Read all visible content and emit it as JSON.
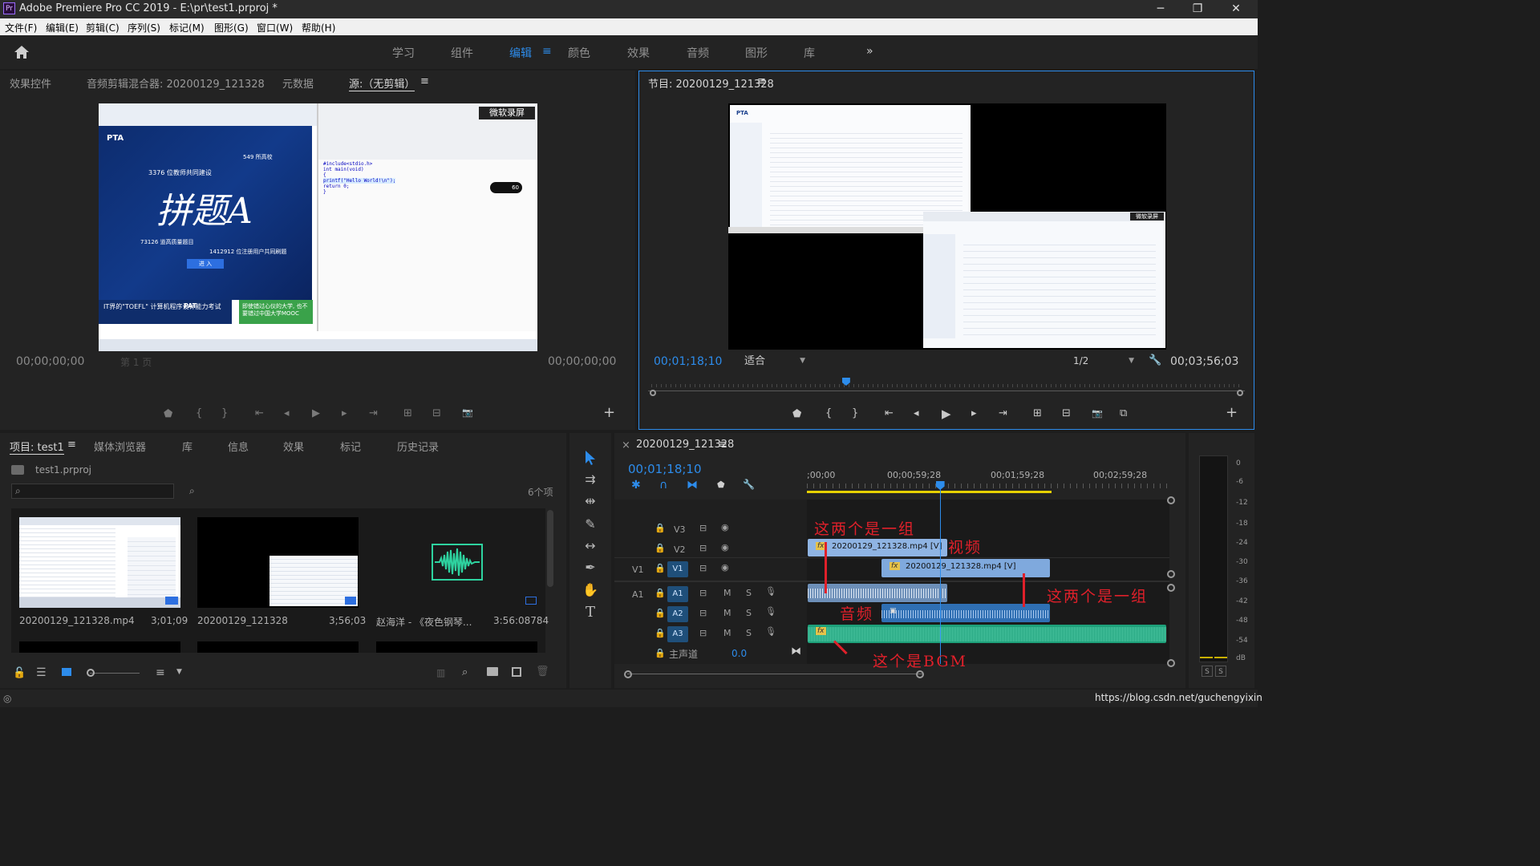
{
  "app": {
    "title": "Adobe Premiere Pro CC 2019 - E:\\pr\\test1.prproj *",
    "logo_text": "Pr"
  },
  "window_controls": {
    "minimize": "─",
    "maximize": "❐",
    "close": "✕"
  },
  "menu": [
    "文件(F)",
    "编辑(E)",
    "剪辑(C)",
    "序列(S)",
    "标记(M)",
    "图形(G)",
    "窗口(W)",
    "帮助(H)"
  ],
  "workspaces": {
    "items": [
      "学习",
      "组件",
      "编辑",
      "颜色",
      "效果",
      "音频",
      "图形",
      "库"
    ],
    "active": "编辑",
    "menu_glyph": "≡",
    "overflow": "»"
  },
  "source_panel": {
    "tabs": [
      "效果控件",
      "音频剪辑混合器: 20200129_121328",
      "元数据",
      "源:（无剪辑）"
    ],
    "menu_glyph": "≡",
    "timecode_left": "00;00;00;00",
    "timecode_right": "00;00;00;00",
    "page_selector": "第 1 页",
    "preview_text": {
      "pta_logo": "PTA",
      "banner_3376": "3376 位教师共同建设",
      "big_title": "拼题A",
      "num_549": "549 所高校",
      "num_73126": "73126 道高质量题目",
      "num_1412912": "1412912 位注册用户共同刷题",
      "enter": "进 入",
      "ad_left": "IT界的\"TOEFL\" 计算机程序设计能力考试",
      "ad_pat": "PAT",
      "ad_right": "即使错过心仪的大学, 也不要错过中国大学MOOC",
      "watermark": "微软录屏",
      "badge": "60",
      "code": [
        "#include<stdio.h>",
        "int main(void)",
        "{",
        "    printf(\"Hello World!\\n\");",
        "    return 0;",
        "}"
      ]
    }
  },
  "program_panel": {
    "title": "节目: 20200129_121328",
    "menu_glyph": "≡",
    "timecode_current": "00;01;18;10",
    "fit": "适合",
    "resolution": "1/2",
    "timecode_duration": "00;03;56;03",
    "playhead_fraction": 0.33,
    "preview_text": {
      "pta_logo": "PTA",
      "watermark": "微软录屏"
    }
  },
  "transport_glyphs": {
    "marker": "⬟",
    "in": "{",
    "out": "}",
    "go_in": "⇤",
    "step_back": "◂",
    "play": "▶",
    "step_fwd": "▸",
    "go_out": "⇥",
    "insert": "⊞",
    "overwrite": "⊟",
    "export": "📷",
    "compare": "⧉",
    "add": "+",
    "wrench": "🔧"
  },
  "project_panel": {
    "tabs": [
      "项目: test1",
      "媒体浏览器",
      "库",
      "信息",
      "效果",
      "标记",
      "历史记录"
    ],
    "menu_glyph": "≡",
    "project_file": "test1.prproj",
    "search_placeholder": "",
    "item_count": "6个项",
    "items": [
      {
        "name": "20200129_121328.mp4",
        "duration": "3;01;09"
      },
      {
        "name": "20200129_121328",
        "duration": "3;56;03"
      },
      {
        "name": "赵海洋 - 《夜色钢琴...",
        "duration": "3:56:08784"
      }
    ]
  },
  "tools": [
    "selection",
    "track-select",
    "ripple-edit",
    "razor",
    "slip",
    "pen",
    "hand",
    "type"
  ],
  "timeline": {
    "sequence_name": "20200129_121328",
    "menu_glyph": "≡",
    "close_glyph": "×",
    "timecode": "00;01;18;10",
    "ruler": [
      ";00;00",
      "00;00;59;28",
      "00;01;59;28",
      "00;02;59;28"
    ],
    "playhead_fraction": 0.36,
    "tracks": [
      {
        "id": "V3",
        "source": "",
        "kind": "video"
      },
      {
        "id": "V2",
        "source": "",
        "kind": "video"
      },
      {
        "id": "V1",
        "source": "V1",
        "kind": "video"
      },
      {
        "id": "A1",
        "source": "A1",
        "kind": "audio"
      },
      {
        "id": "A2",
        "source": "",
        "kind": "audio"
      },
      {
        "id": "A3",
        "source": "",
        "kind": "audio"
      }
    ],
    "track_buttons": {
      "toggle": "⊟",
      "eye": "◉",
      "mute": "M",
      "solo": "S",
      "mic": "🎙"
    },
    "master": {
      "label": "主声道",
      "value": "0.0"
    },
    "clips": [
      {
        "track": "V2",
        "label": "20200129_121328.mp4 [V]",
        "fx": "fx"
      },
      {
        "track": "V1",
        "label": "20200129_121328.mp4 [V]",
        "fx": "fx"
      }
    ],
    "annotations": [
      "这两个是一组",
      "视频",
      "这两个是一组",
      "音频",
      "这个是BGM"
    ]
  },
  "audio_meter": {
    "scale": [
      "0",
      "-6",
      "-12",
      "-18",
      "-24",
      "-30",
      "-36",
      "-42",
      "-48",
      "-54",
      "dB"
    ],
    "solo_left": "S",
    "solo_right": "S"
  },
  "watermark_url": "https://blog.csdn.net/guchengyixin",
  "colors": {
    "accent_blue": "#2d8ceb",
    "video_clip": "#7fa9dd",
    "audio_clip": "#2f6fb3",
    "bgm_clip": "#1ea07a",
    "work_area": "#e6d100",
    "annotation_red": "#e0202a"
  }
}
